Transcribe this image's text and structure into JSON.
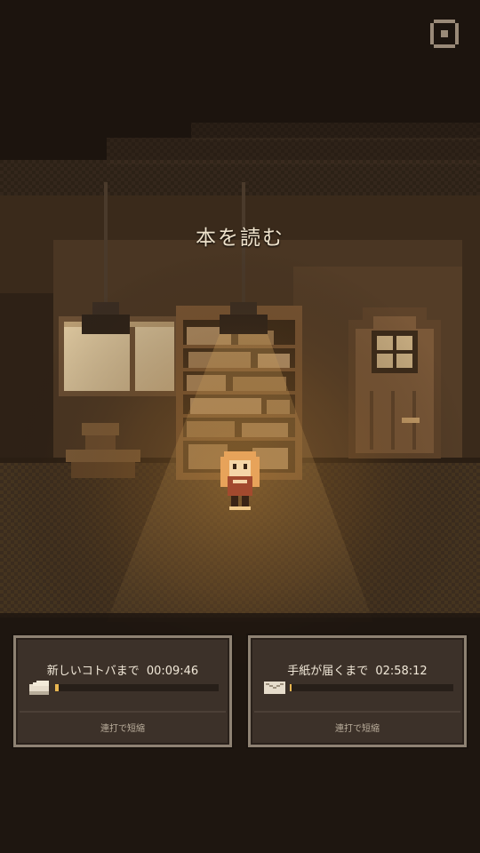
{
  "scene": {
    "title": "本を読む"
  },
  "settings": {
    "icon": "settings-icon"
  },
  "timers": [
    {
      "label": "新しいコトバまで",
      "time": "00:09:46",
      "progress": 0.02,
      "icon": "book-icon",
      "hint": "連打で短縮"
    },
    {
      "label": "手紙が届くまで",
      "time": "02:58:12",
      "progress": 0.01,
      "icon": "envelope-icon",
      "hint": "連打で短縮"
    }
  ],
  "colors": {
    "accent": "#e9b650",
    "panel": "#3c3129",
    "panel_border": "#8e8273",
    "text": "#f1e8d8"
  }
}
